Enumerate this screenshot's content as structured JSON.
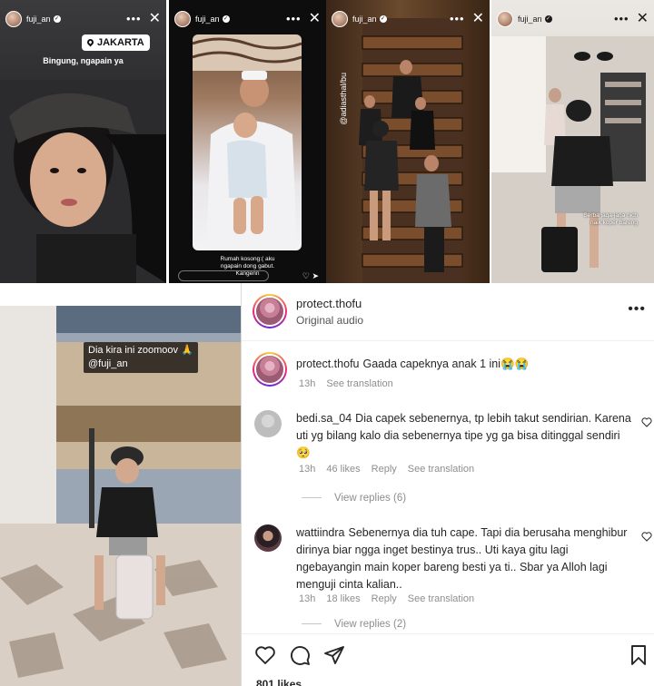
{
  "stories": [
    {
      "username": "fuji_an",
      "location": "JAKARTA",
      "caption": "Bingung, ngapain ya"
    },
    {
      "username": "fuji_an",
      "caption_lines": [
        "Rumah kosong:( aku",
        "ngapain dong gabut.",
        "Kangenn"
      ]
    },
    {
      "username": "fuji_an",
      "side_text": "@adiasthal/bu"
    },
    {
      "username": "fuji_an",
      "caption_lines": [
        "Serba jaga-jaga nich",
        "naik koper bareng"
      ]
    }
  ],
  "video": {
    "caption_line1": "Dia kira ini zoomoov 🙏",
    "caption_line2": "@fuji_an"
  },
  "post": {
    "username": "protect.thofu",
    "audio": "Original audio",
    "more_icon": "more-icon"
  },
  "comments": [
    {
      "username": "protect.thofu",
      "text": "Gaada capeknya anak 1 ini😭😭",
      "time": "13h",
      "translate": "See translation"
    },
    {
      "username": "bedi.sa_04",
      "text": "Dia capek sebenernya, tp lebih takut sendirian. Karena uti yg bilang kalo dia sebenernya tipe yg ga bisa ditinggal sendiri 🥺",
      "time": "13h",
      "likes": "46 likes",
      "reply": "Reply",
      "translate": "See translation",
      "view_replies": "View replies (6)"
    },
    {
      "username": "wattiindra",
      "text": "Sebenernya dia tuh cape. Tapi dia berusaha menghibur dirinya biar ngga inget bestinya trus.. Uti kaya gitu lagi ngebayangin main koper bareng besti ya ti.. Sbar ya Alloh lagi menguji cinta kalian..",
      "time": "13h",
      "likes": "18 likes",
      "reply": "Reply",
      "translate": "See translation",
      "view_replies": "View replies (2)"
    }
  ],
  "footer": {
    "likes": "801 likes"
  },
  "colors": {
    "text": "#262626",
    "muted": "#8e8e8e",
    "divider": "#efefef"
  }
}
